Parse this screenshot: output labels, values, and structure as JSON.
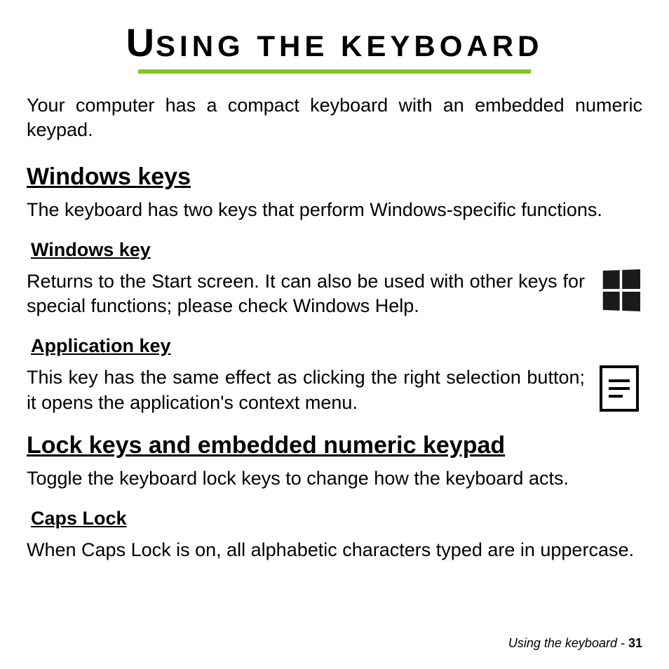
{
  "title_big": "U",
  "title_rest": "SING THE KEYBOARD",
  "intro": "Your computer has a compact keyboard with an embedded numeric keypad.",
  "section1": {
    "heading": "Windows keys",
    "desc": "The keyboard has two keys that perform Windows-specific functions.",
    "sub1": {
      "heading": "Windows key",
      "text": "Returns to the Start screen. It can also be used with other keys for special functions; please check Windows Help."
    },
    "sub2": {
      "heading": "Application key",
      "text": "This key has the same effect as clicking the right selection button; it opens the application's context menu."
    }
  },
  "section2": {
    "heading": "Lock keys and embedded numeric keypad",
    "desc": "Toggle the keyboard lock keys to change how the keyboard acts.",
    "sub1": {
      "heading": "Caps Lock",
      "text": "When Caps Lock is on, all alphabetic characters typed are in uppercase."
    }
  },
  "footer": {
    "chapter": "Using the keyboard - ",
    "page": " 31"
  }
}
